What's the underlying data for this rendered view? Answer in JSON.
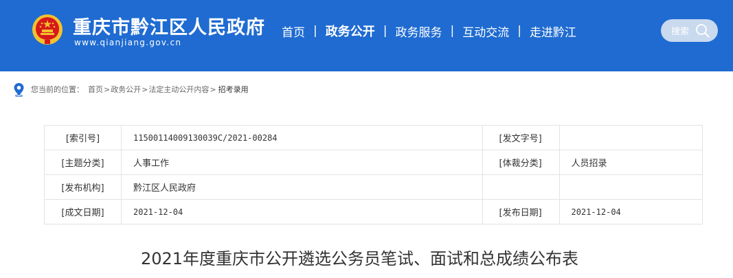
{
  "header": {
    "site_name": "重庆市黔江区人民政府",
    "site_url": "www.qianjiang.gov.cn",
    "colors": {
      "header_bg": "#1f6bd1",
      "emblem_red": "#d7191b",
      "emblem_gold": "#f2c12e"
    }
  },
  "nav": {
    "items": [
      {
        "label": "首页",
        "active": false
      },
      {
        "label": "政务公开",
        "active": true
      },
      {
        "label": "政务服务",
        "active": false
      },
      {
        "label": "互动交流",
        "active": false
      },
      {
        "label": "走进黔江",
        "active": false
      }
    ],
    "separator": "|"
  },
  "search": {
    "label": "搜索",
    "icon": "search-icon"
  },
  "breadcrumb": {
    "prefix": "您当前的位置：",
    "items": [
      "首页",
      "政务公开",
      "法定主动公开内容"
    ],
    "separator": ">",
    "current": "招考录用",
    "icon": "location-pin-icon"
  },
  "info": {
    "rows": [
      [
        "[索引号]",
        "11500114009130039C/2021-00284",
        "[发文字号]",
        ""
      ],
      [
        "[主题分类]",
        "人事工作",
        "[体裁分类]",
        "人员招录"
      ],
      [
        "[发布机构]",
        "黔江区人民政府",
        "",
        ""
      ],
      [
        "[成文日期]",
        "2021-12-04",
        "[发布日期]",
        "2021-12-04"
      ]
    ]
  },
  "article": {
    "title": "2021年度重庆市公开遴选公务员笔试、面试和总成绩公布表"
  }
}
